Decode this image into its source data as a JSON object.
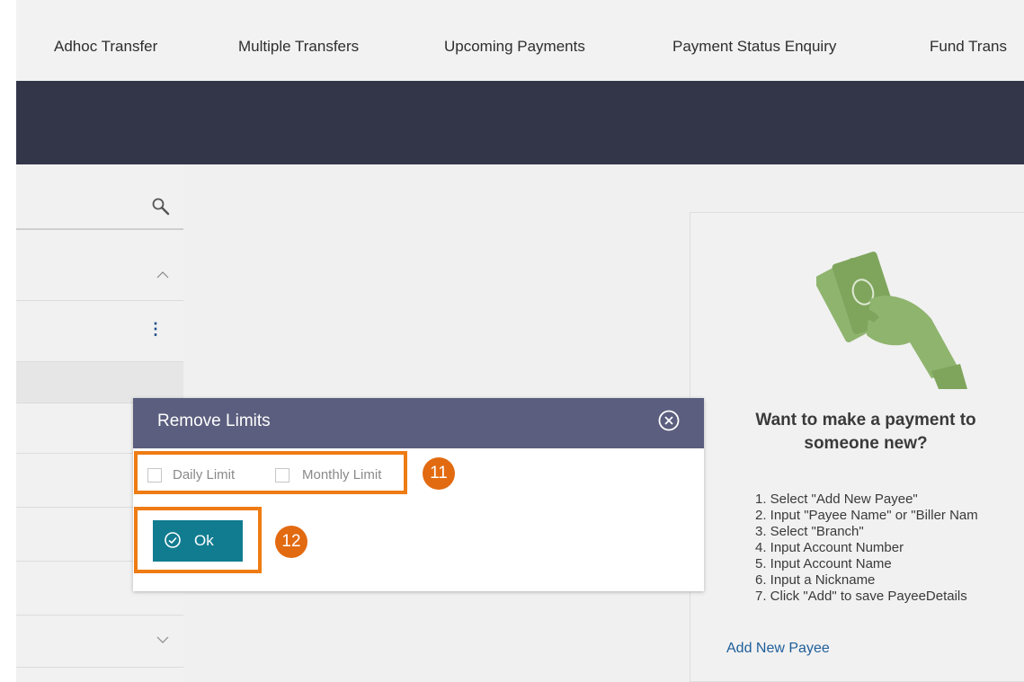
{
  "nav": {
    "tabs": [
      "Adhoc Transfer",
      "Multiple Transfers",
      "Upcoming Payments",
      "Payment Status Enquiry",
      "Fund Trans"
    ]
  },
  "card": {
    "title_line1": "Want to make a payment to",
    "title_line2": "someone new?",
    "steps": [
      "1. Select \"Add New Payee\"",
      "2. Input \"Payee Name\" or \"Biller Nam",
      "3. Select \"Branch\"",
      "4. Input Account Number",
      "5. Input Account Name",
      "6. Input a Nickname",
      "7. Click \"Add\" to save PayeeDetails"
    ],
    "add_link": "Add New Payee",
    "illustration_icon": "hand-holding-money-icon",
    "illustration_color": "#8fb46e"
  },
  "modal": {
    "title": "Remove Limits",
    "close_icon": "close-circle-icon",
    "daily_limit_label": "Daily Limit",
    "monthly_limit_label": "Monthly Limit",
    "ok_label": "Ok",
    "ok_icon": "check-circle-icon",
    "step_badges": [
      "11",
      "12"
    ],
    "header_color": "#5b5e7e",
    "button_color": "#117c8f",
    "highlight_color": "#ef7b13"
  },
  "left_panel": {
    "search_icon": "search-icon",
    "expand_icon": "chevron-up-icon",
    "collapse_icon": "chevron-down-icon",
    "menu_icon": "kebab-menu-icon"
  }
}
